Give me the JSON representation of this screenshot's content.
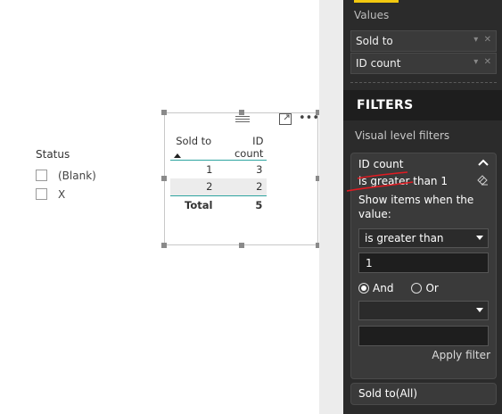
{
  "slicer": {
    "title": "Status",
    "items": [
      {
        "label": "(Blank)",
        "checked": false
      },
      {
        "label": "X",
        "checked": false
      }
    ]
  },
  "table": {
    "columns": [
      "Sold to",
      "ID count"
    ],
    "sort_column": "Sold to",
    "rows": [
      [
        "1",
        "3"
      ],
      [
        "2",
        "2"
      ]
    ],
    "total": {
      "label": "Total",
      "value": "5"
    },
    "accent_color": "#2ea4a0"
  },
  "pane": {
    "values_label": "Values",
    "fields": [
      "Sold to",
      "ID count"
    ],
    "filters_header": "FILTERS",
    "visual_level_label": "Visual level filters",
    "active_filter": {
      "field": "ID count",
      "summary": "is greater than 1",
      "show_items_text": "Show items when the value:",
      "condition1": "is greater than",
      "value1": "1",
      "and_label": "And",
      "or_label": "Or",
      "logic_selected": "And",
      "condition2": "",
      "value2": "",
      "apply_label": "Apply filter"
    },
    "collapsed_filter": "Sold to(All)",
    "colors": {
      "pane_bg": "#2b2b2b",
      "card_bg": "#3a3a3a",
      "tab_accent": "#f2c80f",
      "annotation_red": "#e11b22"
    }
  }
}
